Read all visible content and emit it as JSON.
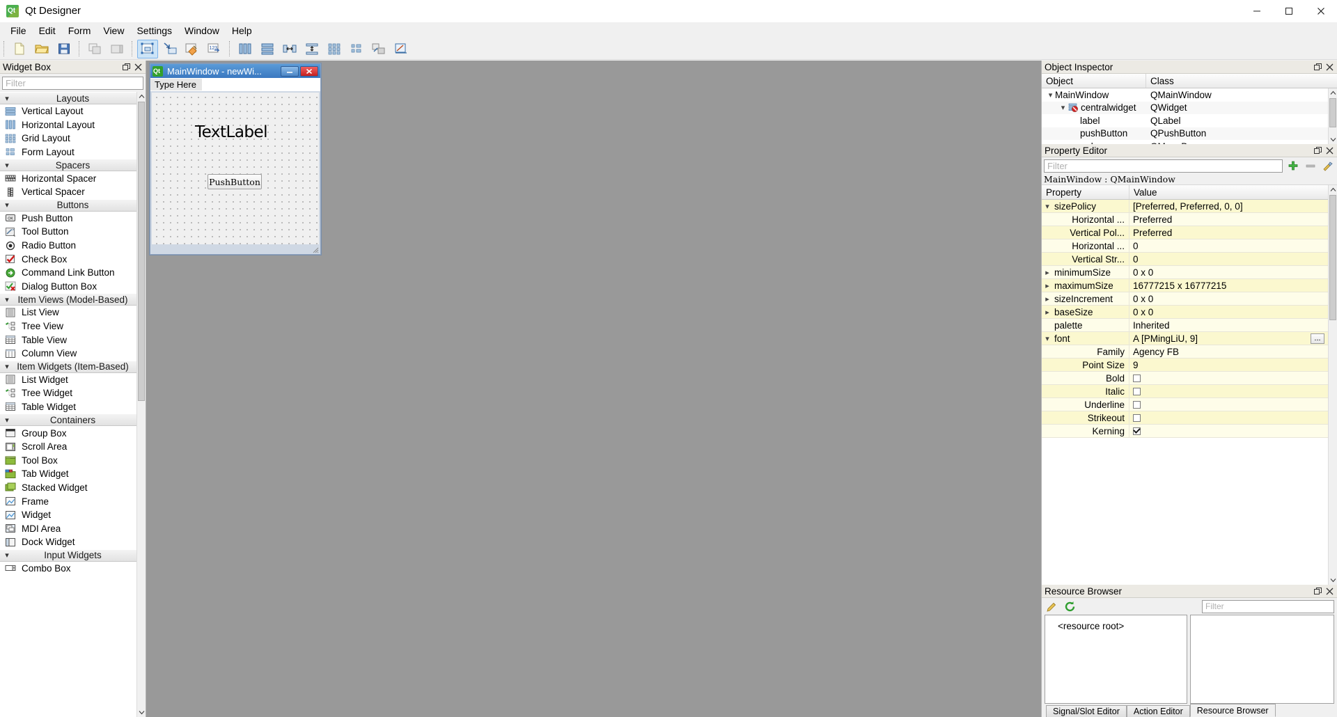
{
  "app": {
    "title": "Qt Designer",
    "icon": "qt-logo-icon"
  },
  "window_controls": {
    "minimize": "minimize-icon",
    "maximize": "maximize-icon",
    "close": "close-icon"
  },
  "menubar": {
    "items": [
      "File",
      "Edit",
      "Form",
      "View",
      "Settings",
      "Window",
      "Help"
    ]
  },
  "toolbar": {
    "groups": [
      {
        "buttons": [
          {
            "name": "new-form-button",
            "icon": "new-file-icon"
          },
          {
            "name": "open-form-button",
            "icon": "open-folder-icon"
          },
          {
            "name": "save-form-button",
            "icon": "save-disk-icon"
          }
        ]
      },
      {
        "buttons": [
          {
            "name": "undo-button",
            "icon": "undo-icon"
          },
          {
            "name": "redo-button",
            "icon": "redo-icon"
          }
        ]
      },
      {
        "buttons": [
          {
            "name": "edit-widgets-button",
            "icon": "edit-widgets-icon",
            "active": true
          },
          {
            "name": "edit-signals-slots-button",
            "icon": "signals-slots-icon",
            "active": false
          },
          {
            "name": "edit-buddies-button",
            "icon": "buddies-icon",
            "active": false
          },
          {
            "name": "edit-tab-order-button",
            "icon": "tab-order-icon",
            "active": false
          }
        ]
      },
      {
        "buttons": [
          {
            "name": "layout-horizontally-button",
            "icon": "layout-horizontal-icon"
          },
          {
            "name": "layout-vertically-button",
            "icon": "layout-vertical-icon"
          },
          {
            "name": "layout-splitter-horizontal-button",
            "icon": "splitter-horizontal-icon"
          },
          {
            "name": "layout-splitter-vertical-button",
            "icon": "splitter-vertical-icon"
          },
          {
            "name": "layout-grid-button",
            "icon": "layout-grid-icon"
          },
          {
            "name": "layout-form-button",
            "icon": "layout-form-icon"
          },
          {
            "name": "break-layout-button",
            "icon": "break-layout-icon"
          },
          {
            "name": "adjust-size-button",
            "icon": "adjust-size-icon"
          }
        ]
      }
    ]
  },
  "widget_box": {
    "title": "Widget Box",
    "filter_placeholder": "Filter",
    "categories": [
      {
        "label": "Layouts",
        "expanded": true,
        "items": [
          {
            "label": "Vertical Layout",
            "icon": "vertical-layout-icon"
          },
          {
            "label": "Horizontal Layout",
            "icon": "horizontal-layout-icon"
          },
          {
            "label": "Grid Layout",
            "icon": "grid-layout-icon"
          },
          {
            "label": "Form Layout",
            "icon": "form-layout-icon"
          }
        ]
      },
      {
        "label": "Spacers",
        "expanded": true,
        "items": [
          {
            "label": "Horizontal Spacer",
            "icon": "horizontal-spacer-icon"
          },
          {
            "label": "Vertical Spacer",
            "icon": "vertical-spacer-icon"
          }
        ]
      },
      {
        "label": "Buttons",
        "expanded": true,
        "items": [
          {
            "label": "Push Button",
            "icon": "push-button-icon"
          },
          {
            "label": "Tool Button",
            "icon": "tool-button-icon"
          },
          {
            "label": "Radio Button",
            "icon": "radio-button-icon"
          },
          {
            "label": "Check Box",
            "icon": "check-box-icon"
          },
          {
            "label": "Command Link Button",
            "icon": "command-link-icon"
          },
          {
            "label": "Dialog Button Box",
            "icon": "dialog-button-box-icon"
          }
        ]
      },
      {
        "label": "Item Views (Model-Based)",
        "expanded": true,
        "items": [
          {
            "label": "List View",
            "icon": "list-view-icon"
          },
          {
            "label": "Tree View",
            "icon": "tree-view-icon"
          },
          {
            "label": "Table View",
            "icon": "table-view-icon"
          },
          {
            "label": "Column View",
            "icon": "column-view-icon"
          }
        ]
      },
      {
        "label": "Item Widgets (Item-Based)",
        "expanded": true,
        "items": [
          {
            "label": "List Widget",
            "icon": "list-widget-icon"
          },
          {
            "label": "Tree Widget",
            "icon": "tree-widget-icon"
          },
          {
            "label": "Table Widget",
            "icon": "table-widget-icon"
          }
        ]
      },
      {
        "label": "Containers",
        "expanded": true,
        "items": [
          {
            "label": "Group Box",
            "icon": "group-box-icon"
          },
          {
            "label": "Scroll Area",
            "icon": "scroll-area-icon"
          },
          {
            "label": "Tool Box",
            "icon": "tool-box-icon"
          },
          {
            "label": "Tab Widget",
            "icon": "tab-widget-icon"
          },
          {
            "label": "Stacked Widget",
            "icon": "stacked-widget-icon"
          },
          {
            "label": "Frame",
            "icon": "frame-icon"
          },
          {
            "label": "Widget",
            "icon": "widget-icon"
          },
          {
            "label": "MDI Area",
            "icon": "mdi-area-icon"
          },
          {
            "label": "Dock Widget",
            "icon": "dock-widget-icon"
          }
        ]
      },
      {
        "label": "Input Widgets",
        "expanded": true,
        "items": [
          {
            "label": "Combo Box",
            "icon": "combo-box-icon"
          }
        ]
      }
    ]
  },
  "form_preview": {
    "title": "MainWindow - newWi...",
    "icon": "qt-logo-icon",
    "menu_placeholder": "Type Here",
    "label_text": "TextLabel",
    "button_text": "PushButton",
    "buttons": {
      "minimize": "minimize-icon",
      "close": "close-icon"
    }
  },
  "object_inspector": {
    "title": "Object Inspector",
    "columns": [
      "Object",
      "Class"
    ],
    "rows": [
      {
        "object": "MainWindow",
        "class": "QMainWindow",
        "indent": 0,
        "expandable": true,
        "icon": null
      },
      {
        "object": "centralwidget",
        "class": "QWidget",
        "indent": 1,
        "expandable": true,
        "icon": "no-layout-icon"
      },
      {
        "object": "label",
        "class": "QLabel",
        "indent": 2,
        "expandable": false,
        "icon": null
      },
      {
        "object": "pushButton",
        "class": "QPushButton",
        "indent": 2,
        "expandable": false,
        "icon": null
      },
      {
        "object": "menubar",
        "class": "QMenuBar",
        "indent": 1,
        "expandable": false,
        "icon": null
      }
    ]
  },
  "property_editor": {
    "title": "Property Editor",
    "filter_placeholder": "Filter",
    "object_line": "MainWindow : QMainWindow",
    "columns": [
      "Property",
      "Value"
    ],
    "rows": [
      {
        "name": "sizePolicy",
        "value": "[Preferred, Preferred, 0, 0]",
        "level": 0,
        "expandable": true,
        "expanded": true,
        "type": "text"
      },
      {
        "name": "Horizontal ...",
        "value": "Preferred",
        "level": 1,
        "expandable": false,
        "type": "text"
      },
      {
        "name": "Vertical Pol...",
        "value": "Preferred",
        "level": 1,
        "expandable": false,
        "type": "text"
      },
      {
        "name": "Horizontal ...",
        "value": "0",
        "level": 1,
        "expandable": false,
        "type": "text"
      },
      {
        "name": "Vertical Str...",
        "value": "0",
        "level": 1,
        "expandable": false,
        "type": "text"
      },
      {
        "name": "minimumSize",
        "value": "0 x 0",
        "level": 0,
        "expandable": true,
        "expanded": false,
        "type": "text"
      },
      {
        "name": "maximumSize",
        "value": "16777215 x 16777215",
        "level": 0,
        "expandable": true,
        "expanded": false,
        "type": "text"
      },
      {
        "name": "sizeIncrement",
        "value": "0 x 0",
        "level": 0,
        "expandable": true,
        "expanded": false,
        "type": "text"
      },
      {
        "name": "baseSize",
        "value": "0 x 0",
        "level": 0,
        "expandable": true,
        "expanded": false,
        "type": "text"
      },
      {
        "name": "palette",
        "value": "Inherited",
        "level": 0,
        "expandable": false,
        "type": "text"
      },
      {
        "name": "font",
        "value": "A [PMingLiU, 9]",
        "level": 0,
        "expandable": true,
        "expanded": true,
        "type": "font"
      },
      {
        "name": "Family",
        "value": "Agency FB",
        "level": 1,
        "expandable": false,
        "type": "text"
      },
      {
        "name": "Point Size",
        "value": "9",
        "level": 1,
        "expandable": false,
        "type": "text"
      },
      {
        "name": "Bold",
        "value": "",
        "level": 1,
        "expandable": false,
        "type": "checkbox",
        "checked": false
      },
      {
        "name": "Italic",
        "value": "",
        "level": 1,
        "expandable": false,
        "type": "checkbox",
        "checked": false
      },
      {
        "name": "Underline",
        "value": "",
        "level": 1,
        "expandable": false,
        "type": "checkbox",
        "checked": false
      },
      {
        "name": "Strikeout",
        "value": "",
        "level": 1,
        "expandable": false,
        "type": "checkbox",
        "checked": false
      },
      {
        "name": "Kerning",
        "value": "",
        "level": 1,
        "expandable": false,
        "type": "checkbox",
        "checked": true
      }
    ],
    "tools": {
      "add_label": "add-property-icon",
      "remove_label": "remove-property-icon",
      "config_label": "configure-icon"
    }
  },
  "resource_browser": {
    "title": "Resource Browser",
    "edit_icon": "pencil-edit-icon",
    "reload_icon": "reload-icon",
    "filter_placeholder": "Filter",
    "root_label": "<resource root>",
    "tabs": [
      {
        "label": "Signal/Slot Editor",
        "selected": false
      },
      {
        "label": "Action Editor",
        "selected": false
      },
      {
        "label": "Resource Browser",
        "selected": true
      }
    ]
  },
  "colors": {
    "accent_blue": "#3b78c0",
    "panel_bg": "#f0f0f0",
    "canvas_bg": "#999999",
    "property_yellow": "#fbf8cf",
    "property_yellow_light": "#fefde9"
  }
}
